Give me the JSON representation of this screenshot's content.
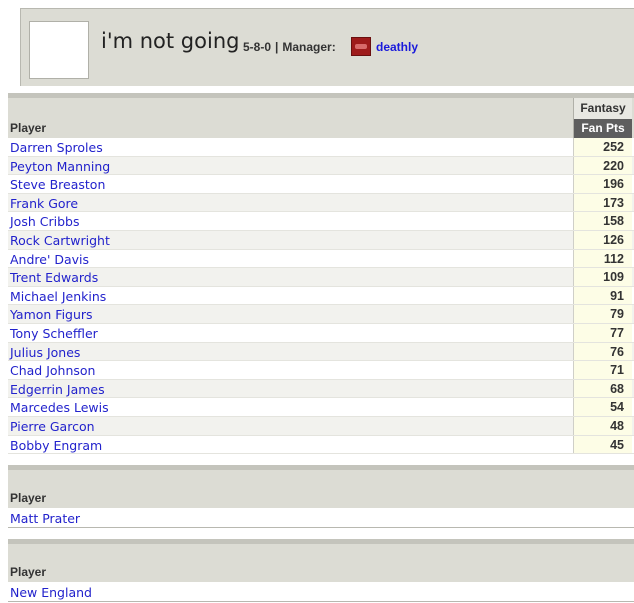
{
  "team": {
    "name": "i'm not going",
    "record": "5-8-0",
    "separator": "|",
    "manager_label": "Manager:",
    "manager_name": "deathly"
  },
  "offense": {
    "player_header": "Player",
    "group_header": "Fantasy",
    "points_header": "Fan Pts",
    "players": [
      {
        "name": "Darren Sproles",
        "pts": "252"
      },
      {
        "name": "Peyton Manning",
        "pts": "220"
      },
      {
        "name": "Steve Breaston",
        "pts": "196"
      },
      {
        "name": "Frank Gore",
        "pts": "173"
      },
      {
        "name": "Josh Cribbs",
        "pts": "158"
      },
      {
        "name": "Rock Cartwright",
        "pts": "126"
      },
      {
        "name": "Andre' Davis",
        "pts": "112"
      },
      {
        "name": "Trent Edwards",
        "pts": "109"
      },
      {
        "name": "Michael Jenkins",
        "pts": "91"
      },
      {
        "name": "Yamon Figurs",
        "pts": "79"
      },
      {
        "name": "Tony Scheffler",
        "pts": "77"
      },
      {
        "name": "Julius Jones",
        "pts": "76"
      },
      {
        "name": "Chad Johnson",
        "pts": "71"
      },
      {
        "name": "Edgerrin James",
        "pts": "68"
      },
      {
        "name": "Marcedes Lewis",
        "pts": "54"
      },
      {
        "name": "Pierre Garcon",
        "pts": "48"
      },
      {
        "name": "Bobby Engram",
        "pts": "45"
      }
    ]
  },
  "kickers": {
    "player_header": "Player",
    "players": [
      {
        "name": "Matt Prater"
      }
    ]
  },
  "defense": {
    "player_header": "Player",
    "players": [
      {
        "name": "New England"
      }
    ]
  }
}
